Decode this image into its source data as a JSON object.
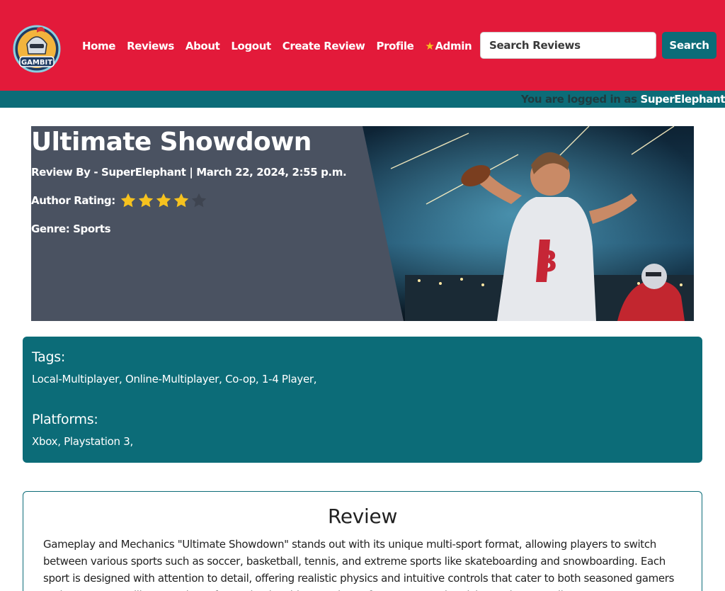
{
  "navbar": {
    "logo_text": "GAMBIT",
    "links": [
      {
        "label": "Home"
      },
      {
        "label": "Reviews"
      },
      {
        "label": "About"
      },
      {
        "label": "Logout"
      },
      {
        "label": "Create Review"
      },
      {
        "label": "Profile"
      },
      {
        "label": "Admin",
        "icon": "star-icon"
      }
    ],
    "search_placeholder": "Search Reviews",
    "search_button": "Search"
  },
  "login_bar": {
    "prefix": "You are logged in as",
    "username": "SuperElephant"
  },
  "review": {
    "title": "Ultimate Showdown",
    "meta": "Review By - SuperElephant | March 22, 2024, 2:55 p.m.",
    "rating_label": "Author Rating:",
    "rating_value": 4,
    "rating_max": 5,
    "genre": "Genre: Sports",
    "tags_heading": "Tags:",
    "tags": "Local-Multiplayer, Online-Multiplayer, Co-op, 1-4 Player,",
    "platforms_heading": "Platforms:",
    "platforms": "Xbox, Playstation 3,",
    "review_heading": "Review",
    "review_text": "Gameplay and Mechanics \"Ultimate Showdown\" stands out with its unique multi-sport format, allowing players to switch between various sports such as soccer, basketball, tennis, and extreme sports like skateboarding and snowboarding. Each sport is designed with attention to detail, offering realistic physics and intuitive controls that cater to both seasoned gamers and newcomers alike, ensuring a fun and enjoyable experience for everyone who picks up the controller."
  },
  "colors": {
    "navbar": "#e31a3a",
    "teal": "#0c6c78",
    "hero_bg": "#4a5261",
    "star_filled": "#f6c21f",
    "star_empty": "#3e4450"
  }
}
